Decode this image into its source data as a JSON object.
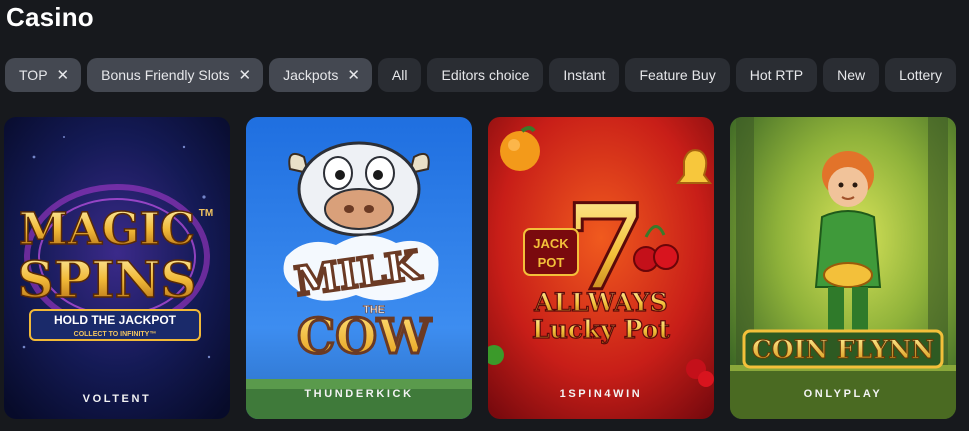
{
  "page": {
    "title": "Casino"
  },
  "filters": [
    {
      "label": "TOP",
      "active": true
    },
    {
      "label": "Bonus Friendly Slots",
      "active": true
    },
    {
      "label": "Jackpots",
      "active": true
    },
    {
      "label": "All",
      "active": false
    },
    {
      "label": "Editors choice",
      "active": false
    },
    {
      "label": "Instant",
      "active": false
    },
    {
      "label": "Feature Buy",
      "active": false
    },
    {
      "label": "Hot RTP",
      "active": false
    },
    {
      "label": "New",
      "active": false
    },
    {
      "label": "Lottery",
      "active": false
    }
  ],
  "games": [
    {
      "art_lines": [
        "MAGIC",
        "SPINS"
      ],
      "trademark": "TM",
      "banner": "HOLD THE JACKPOT",
      "banner_sub": "COLLECT TO INFINITY™",
      "provider": "VOLTENT"
    },
    {
      "art_lines": [
        "MILK",
        "THE",
        "COW"
      ],
      "provider": "THUNDERKICK"
    },
    {
      "badge_lines": [
        "JACK",
        "POT"
      ],
      "art_lines": [
        "ALLWAYS",
        "Lucky Pot"
      ],
      "seven": "7",
      "provider": "1SPIN4WIN"
    },
    {
      "art_lines": [
        "COIN FLYNN"
      ],
      "provider": "ONLYPLAY"
    }
  ],
  "colors": {
    "background": "#17191d",
    "chip": "#2a2d33",
    "chip_active": "#444851"
  }
}
